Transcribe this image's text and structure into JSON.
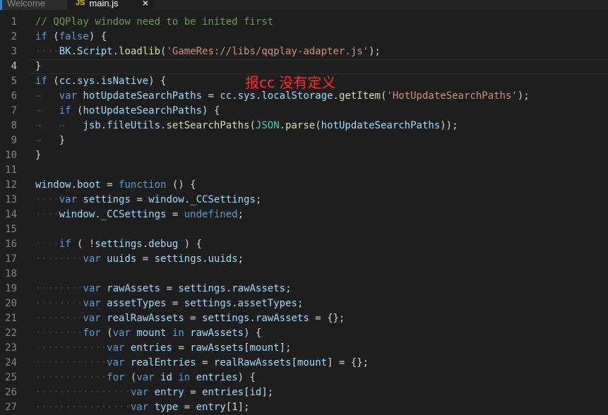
{
  "tabs": [
    {
      "label": "Welcome"
    },
    {
      "badge": "JS",
      "label": "main.js",
      "close": "×"
    }
  ],
  "annotation": "报cc 没有定义",
  "lines": [
    {
      "n": "1",
      "tokens": [
        [
          "cm",
          "// QQPlay window need to be inited first"
        ]
      ]
    },
    {
      "n": "2",
      "tokens": [
        [
          "kw",
          "if"
        ],
        [
          "p",
          " ("
        ],
        [
          "kw",
          "false"
        ],
        [
          "p",
          ") {"
        ]
      ]
    },
    {
      "n": "3",
      "tokens": [
        [
          "ws",
          "····"
        ],
        [
          "var",
          "BK"
        ],
        [
          "p",
          "."
        ],
        [
          "var",
          "Script"
        ],
        [
          "p",
          "."
        ],
        [
          "fn",
          "loadlib"
        ],
        [
          "p",
          "("
        ],
        [
          "str",
          "'GameRes://libs/qqplay-adapter.js'"
        ],
        [
          "p",
          ");"
        ]
      ]
    },
    {
      "n": "4",
      "tokens": [
        [
          "p",
          "}"
        ]
      ]
    },
    {
      "n": "5",
      "tokens": [
        [
          "kw",
          "if"
        ],
        [
          "p",
          " ("
        ],
        [
          "var",
          "cc"
        ],
        [
          "p",
          "."
        ],
        [
          "var",
          "sys"
        ],
        [
          "p",
          "."
        ],
        [
          "var",
          "isNative"
        ],
        [
          "p",
          ") {"
        ]
      ]
    },
    {
      "n": "6",
      "tokens": [
        [
          "ws",
          "→   "
        ],
        [
          "kw",
          "var"
        ],
        [
          "p",
          " "
        ],
        [
          "var",
          "hotUpdateSearchPaths"
        ],
        [
          "p",
          " = "
        ],
        [
          "var",
          "cc"
        ],
        [
          "p",
          "."
        ],
        [
          "var",
          "sys"
        ],
        [
          "p",
          "."
        ],
        [
          "var",
          "localStorage"
        ],
        [
          "p",
          "."
        ],
        [
          "fn",
          "getItem"
        ],
        [
          "p",
          "("
        ],
        [
          "str",
          "'HotUpdateSearchPaths'"
        ],
        [
          "p",
          ");"
        ]
      ]
    },
    {
      "n": "7",
      "tokens": [
        [
          "ws",
          "→   "
        ],
        [
          "kw",
          "if"
        ],
        [
          "p",
          " ("
        ],
        [
          "var",
          "hotUpdateSearchPaths"
        ],
        [
          "p",
          ") {"
        ]
      ]
    },
    {
      "n": "8",
      "tokens": [
        [
          "ws",
          "→   →   "
        ],
        [
          "var",
          "jsb"
        ],
        [
          "p",
          "."
        ],
        [
          "var",
          "fileUtils"
        ],
        [
          "p",
          "."
        ],
        [
          "fn",
          "setSearchPaths"
        ],
        [
          "p",
          "("
        ],
        [
          "cls",
          "JSON"
        ],
        [
          "p",
          "."
        ],
        [
          "fn",
          "parse"
        ],
        [
          "p",
          "("
        ],
        [
          "var",
          "hotUpdateSearchPaths"
        ],
        [
          "p",
          "));"
        ]
      ]
    },
    {
      "n": "9",
      "tokens": [
        [
          "ws",
          "→   "
        ],
        [
          "p",
          "}"
        ]
      ]
    },
    {
      "n": "10",
      "tokens": [
        [
          "p",
          "}"
        ]
      ]
    },
    {
      "n": "11",
      "tokens": []
    },
    {
      "n": "12",
      "tokens": [
        [
          "var",
          "window"
        ],
        [
          "p",
          "."
        ],
        [
          "var",
          "boot"
        ],
        [
          "p",
          " = "
        ],
        [
          "kw",
          "function"
        ],
        [
          "p",
          " () {"
        ]
      ]
    },
    {
      "n": "13",
      "tokens": [
        [
          "ws",
          "····"
        ],
        [
          "kw",
          "var"
        ],
        [
          "p",
          " "
        ],
        [
          "var",
          "settings"
        ],
        [
          "p",
          " = "
        ],
        [
          "var",
          "window"
        ],
        [
          "p",
          "."
        ],
        [
          "var",
          "_CCSettings"
        ],
        [
          "p",
          ";"
        ]
      ]
    },
    {
      "n": "14",
      "tokens": [
        [
          "ws",
          "····"
        ],
        [
          "var",
          "window"
        ],
        [
          "p",
          "."
        ],
        [
          "var",
          "_CCSettings"
        ],
        [
          "p",
          " = "
        ],
        [
          "kw",
          "undefined"
        ],
        [
          "p",
          ";"
        ]
      ]
    },
    {
      "n": "15",
      "tokens": []
    },
    {
      "n": "16",
      "tokens": [
        [
          "ws",
          "····"
        ],
        [
          "kw",
          "if"
        ],
        [
          "p",
          " ( !"
        ],
        [
          "var",
          "settings"
        ],
        [
          "p",
          "."
        ],
        [
          "var",
          "debug"
        ],
        [
          "p",
          " ) {"
        ]
      ]
    },
    {
      "n": "17",
      "tokens": [
        [
          "ws",
          "········"
        ],
        [
          "kw",
          "var"
        ],
        [
          "p",
          " "
        ],
        [
          "var",
          "uuids"
        ],
        [
          "p",
          " = "
        ],
        [
          "var",
          "settings"
        ],
        [
          "p",
          "."
        ],
        [
          "var",
          "uuids"
        ],
        [
          "p",
          ";"
        ]
      ]
    },
    {
      "n": "18",
      "tokens": []
    },
    {
      "n": "19",
      "tokens": [
        [
          "ws",
          "········"
        ],
        [
          "kw",
          "var"
        ],
        [
          "p",
          " "
        ],
        [
          "var",
          "rawAssets"
        ],
        [
          "p",
          " = "
        ],
        [
          "var",
          "settings"
        ],
        [
          "p",
          "."
        ],
        [
          "var",
          "rawAssets"
        ],
        [
          "p",
          ";"
        ]
      ]
    },
    {
      "n": "20",
      "tokens": [
        [
          "ws",
          "········"
        ],
        [
          "kw",
          "var"
        ],
        [
          "p",
          " "
        ],
        [
          "var",
          "assetTypes"
        ],
        [
          "p",
          " = "
        ],
        [
          "var",
          "settings"
        ],
        [
          "p",
          "."
        ],
        [
          "var",
          "assetTypes"
        ],
        [
          "p",
          ";"
        ]
      ]
    },
    {
      "n": "21",
      "tokens": [
        [
          "ws",
          "········"
        ],
        [
          "kw",
          "var"
        ],
        [
          "p",
          " "
        ],
        [
          "var",
          "realRawAssets"
        ],
        [
          "p",
          " = "
        ],
        [
          "var",
          "settings"
        ],
        [
          "p",
          "."
        ],
        [
          "var",
          "rawAssets"
        ],
        [
          "p",
          " = {};"
        ]
      ]
    },
    {
      "n": "22",
      "tokens": [
        [
          "ws",
          "········"
        ],
        [
          "kw",
          "for"
        ],
        [
          "p",
          " ("
        ],
        [
          "kw",
          "var"
        ],
        [
          "p",
          " "
        ],
        [
          "var",
          "mount"
        ],
        [
          "p",
          " "
        ],
        [
          "kw",
          "in"
        ],
        [
          "p",
          " "
        ],
        [
          "var",
          "rawAssets"
        ],
        [
          "p",
          ") {"
        ]
      ]
    },
    {
      "n": "23",
      "tokens": [
        [
          "ws",
          "············"
        ],
        [
          "kw",
          "var"
        ],
        [
          "p",
          " "
        ],
        [
          "var",
          "entries"
        ],
        [
          "p",
          " = "
        ],
        [
          "var",
          "rawAssets"
        ],
        [
          "p",
          "["
        ],
        [
          "var",
          "mount"
        ],
        [
          "p",
          "];"
        ]
      ]
    },
    {
      "n": "24",
      "tokens": [
        [
          "ws",
          "············"
        ],
        [
          "kw",
          "var"
        ],
        [
          "p",
          " "
        ],
        [
          "var",
          "realEntries"
        ],
        [
          "p",
          " = "
        ],
        [
          "var",
          "realRawAssets"
        ],
        [
          "p",
          "["
        ],
        [
          "var",
          "mount"
        ],
        [
          "p",
          "] = {};"
        ]
      ]
    },
    {
      "n": "25",
      "tokens": [
        [
          "ws",
          "············"
        ],
        [
          "kw",
          "for"
        ],
        [
          "p",
          " ("
        ],
        [
          "kw",
          "var"
        ],
        [
          "p",
          " "
        ],
        [
          "var",
          "id"
        ],
        [
          "p",
          " "
        ],
        [
          "kw",
          "in"
        ],
        [
          "p",
          " "
        ],
        [
          "var",
          "entries"
        ],
        [
          "p",
          ") {"
        ]
      ]
    },
    {
      "n": "26",
      "tokens": [
        [
          "ws",
          "················"
        ],
        [
          "kw",
          "var"
        ],
        [
          "p",
          " "
        ],
        [
          "var",
          "entry"
        ],
        [
          "p",
          " = "
        ],
        [
          "var",
          "entries"
        ],
        [
          "p",
          "["
        ],
        [
          "var",
          "id"
        ],
        [
          "p",
          "];"
        ]
      ]
    },
    {
      "n": "27",
      "tokens": [
        [
          "ws",
          "················"
        ],
        [
          "kw",
          "var"
        ],
        [
          "p",
          " "
        ],
        [
          "var",
          "type"
        ],
        [
          "p",
          " = "
        ],
        [
          "var",
          "entry"
        ],
        [
          "p",
          "[1];"
        ]
      ]
    }
  ]
}
